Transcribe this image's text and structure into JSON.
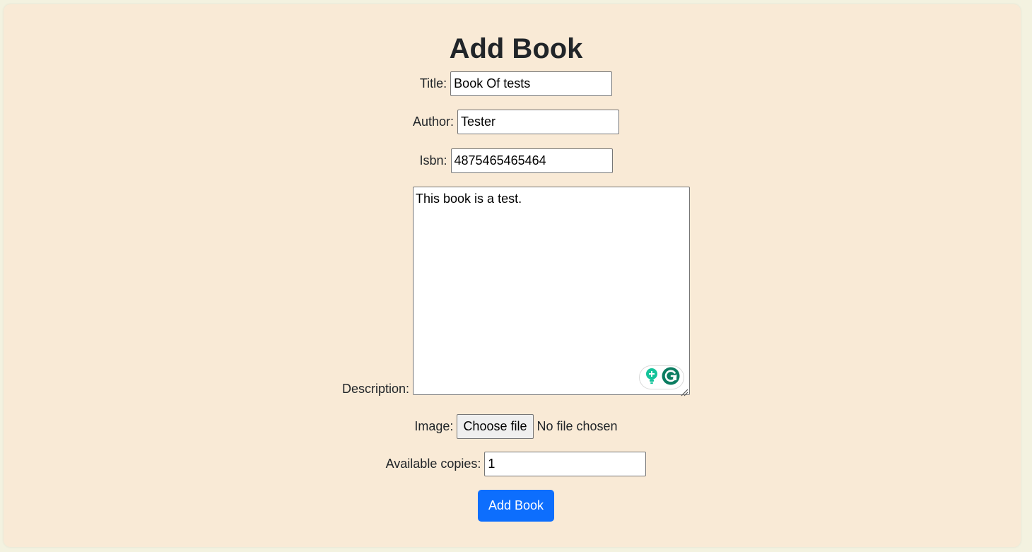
{
  "form": {
    "heading": "Add Book",
    "title": {
      "label": "Title:",
      "value": "Book Of tests"
    },
    "author": {
      "label": "Author:",
      "value": "Tester"
    },
    "isbn": {
      "label": "Isbn:",
      "value": "4875465465464"
    },
    "description": {
      "label": "Description:",
      "value": "This book is a test."
    },
    "image": {
      "label": "Image:",
      "button_label": "Choose file",
      "status": "No file chosen"
    },
    "copies": {
      "label": "Available copies:",
      "value": "1"
    },
    "submit_label": "Add Book"
  },
  "icons": {
    "grammarly_suggestion": "lightbulb-plus-icon",
    "grammarly_logo": "grammarly-g-icon",
    "resize": "resize-grip-icon"
  },
  "colors": {
    "page_background": "#f3f2e0",
    "card_background": "#f9ead6",
    "primary_button": "#0d6efd",
    "grammarly_green": "#15c39a",
    "grammarly_dark": "#0b7d61"
  }
}
